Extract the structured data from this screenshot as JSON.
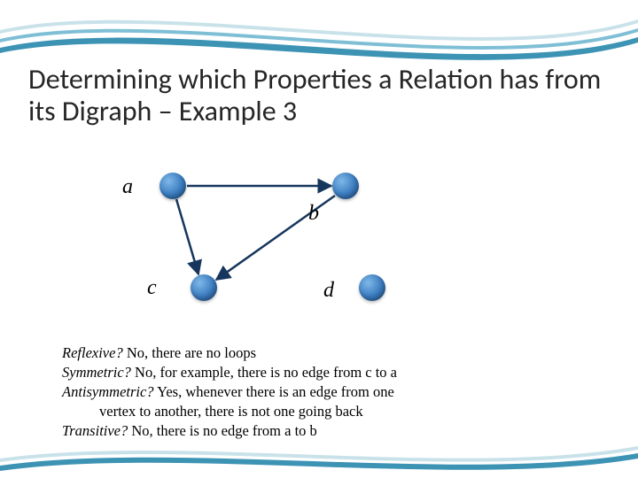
{
  "title": "Determining which Properties a Relation has from its Digraph – Example 3",
  "vertices": {
    "a": "a",
    "b": "b",
    "c": "c",
    "d": "d"
  },
  "answers": {
    "reflexive_q": "Reflexive?",
    "reflexive_a": " No, there are no loops",
    "symmetric_q": "Symmetric?",
    "symmetric_a": "  No, for example, there is no edge from c to a",
    "antisymmetric_q": "Antisymmetric?",
    "antisymmetric_a": " Yes, whenever there is an edge from one",
    "antisymmetric_a2": "vertex  to another, there is not one going back",
    "transitive_q": "Transitive?",
    "transitive_a": " No, there is no edge from a to b"
  },
  "colors": {
    "curve": "#5aa9c8",
    "curve_light": "#c9e2ea"
  }
}
